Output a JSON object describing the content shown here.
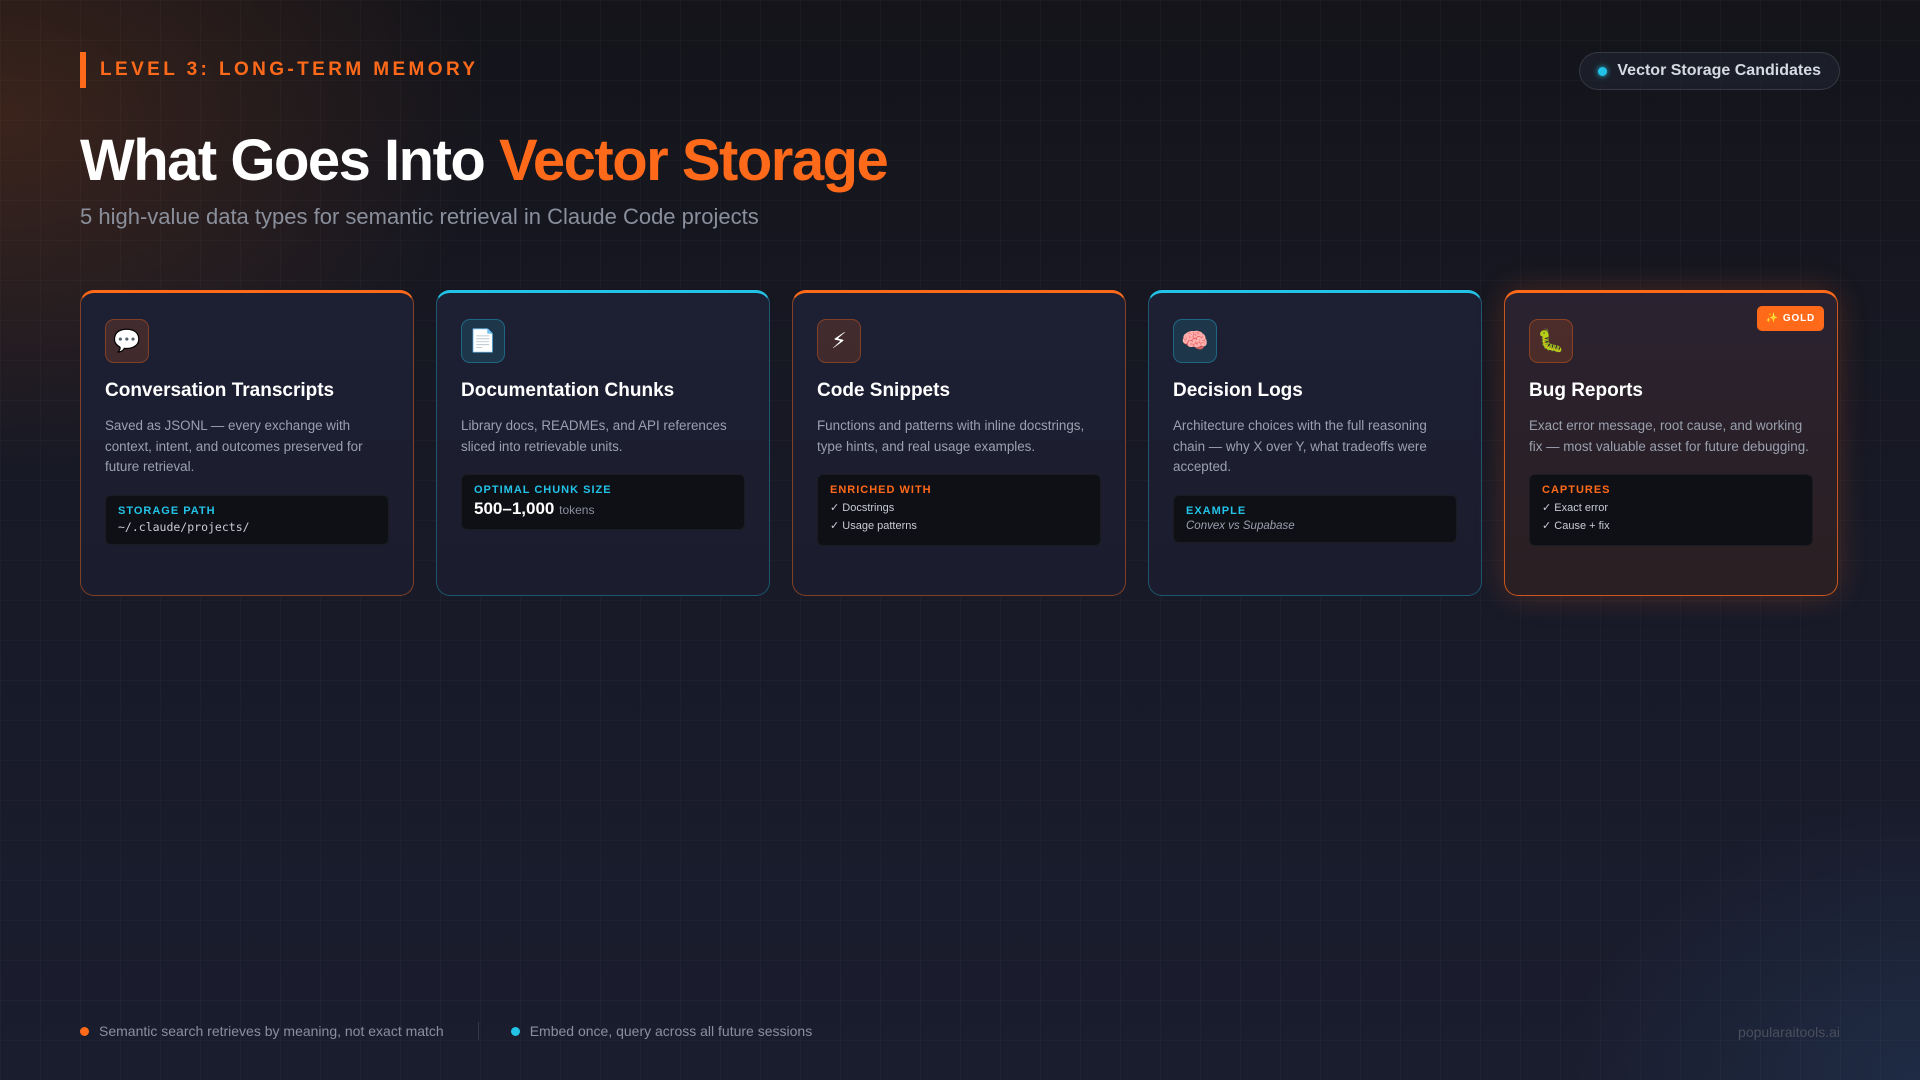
{
  "header": {
    "level_label": "LEVEL 3: LONG-TERM MEMORY",
    "pill_label": "Vector Storage Candidates",
    "title_main": "What Goes Into ",
    "title_accent": "Vector Storage",
    "subtitle": "5 high-value data types for semantic retrieval in Claude Code projects"
  },
  "cards": [
    {
      "icon": "speech-bubble-icon",
      "icon_glyph": "💬",
      "title": "Conversation Transcripts",
      "description": "Saved as JSONL — every exchange with context, intent, and outcomes preserved for future retrieval.",
      "info_label": "STORAGE PATH",
      "info_value": "~/.claude/projects/"
    },
    {
      "icon": "document-icon",
      "icon_glyph": "📄",
      "title": "Documentation Chunks",
      "description": "Library docs, READMEs, and API references sliced into retrievable units.",
      "info_label": "OPTIMAL CHUNK SIZE",
      "info_value": "500–1,000",
      "info_unit": "tokens"
    },
    {
      "icon": "lightning-icon",
      "icon_glyph": "⚡",
      "title": "Code Snippets",
      "description": "Functions and patterns with inline docstrings, type hints, and real usage examples.",
      "info_label": "ENRICHED WITH",
      "info_items": [
        "✓ Docstrings",
        "✓ Usage patterns"
      ]
    },
    {
      "icon": "brain-icon",
      "icon_glyph": "🧠",
      "title": "Decision Logs",
      "description": "Architecture choices with the full reasoning chain — why X over Y, what tradeoffs were accepted.",
      "info_label": "EXAMPLE",
      "info_value": "Convex vs Supabase"
    },
    {
      "icon": "bug-icon",
      "icon_glyph": "🐛",
      "title": "Bug Reports",
      "badge": "GOLD",
      "badge_icon": "✨",
      "description": "Exact error message, root cause, and working fix — most valuable asset for future debugging.",
      "info_label": "CAPTURES",
      "info_items": [
        "✓ Exact error",
        "✓ Cause + fix"
      ]
    }
  ],
  "footer": {
    "item1": "Semantic search retrieves by meaning, not exact match",
    "item2": "Embed once, query across all future sessions",
    "brand": "popularaitools.ai"
  },
  "colors": {
    "accent_orange": "#ff6a1a",
    "accent_cyan": "#22c3e6",
    "background": "#181a28"
  }
}
